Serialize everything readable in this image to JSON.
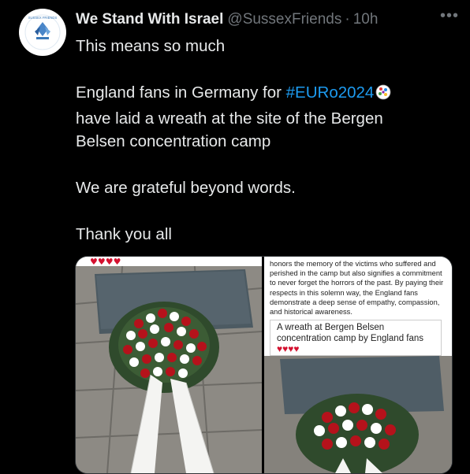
{
  "tweet": {
    "display_name": "We Stand With Israel",
    "handle": "@SussexFriends",
    "separator": "·",
    "timestamp": "10h",
    "more_label": "•••",
    "lines": {
      "l1": "This means so much",
      "l2_prefix": "England fans in Germany for ",
      "l2_hashtag": "#EURo2024",
      "l3": "have laid a wreath at the site of the Bergen",
      "l4": "Belsen concentration camp",
      "l5": "We are grateful beyond words.",
      "l6": "Thank you all"
    },
    "icons": {
      "avatar": "sussex-friends-logo",
      "hashtag_emoji": "soccer-ball-icon",
      "more": "more-options-icon"
    }
  },
  "media": {
    "left_hearts": "♥♥♥♥",
    "article_text": "honors the memory of the victims who suffered and perished in the camp but also signifies a commitment to never forget the horrors of the past. By paying their respects in this solemn way, the England fans demonstrate a deep sense of empathy, compassion, and historical awareness.",
    "caption": "A wreath at Bergen Belsen concentration camp by England fans",
    "caption_hearts": "♥♥♥♥"
  },
  "colors": {
    "background": "#000000",
    "text": "#e7e9ea",
    "muted": "#71767b",
    "link": "#1d9bf0"
  }
}
